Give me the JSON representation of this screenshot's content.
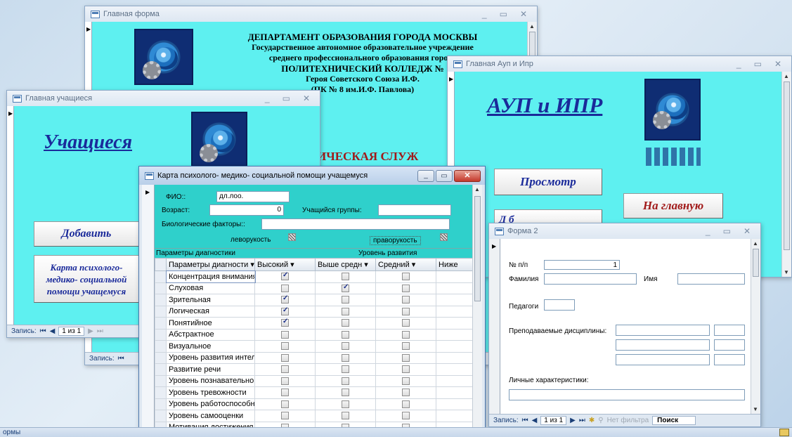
{
  "main_form": {
    "title": "Главная форма",
    "header_lines": [
      "ДЕПАРТАМЕНТ ОБРАЗОВАНИЯ ГОРОДА МОСКВЫ",
      "Государственное автономное образовательное учреждение",
      "среднего профессионального образования города",
      "ПОЛИТЕХНИЧЕСКИЙ КОЛЛЕДЖ №",
      "Героя Советского Союза И.Ф.",
      "(ПК № 8 им.И.Ф. Павлова)"
    ],
    "service_title": "ИЧЕСКАЯ СЛУЖ",
    "nav_record": "Запись:"
  },
  "aup_form": {
    "title": "Главная Ауп и Ипр",
    "heading": "АУП и ИПР",
    "view_button": "Просмотр",
    "home_button": "На главную",
    "partial_button": "Д б"
  },
  "students_form": {
    "title": "Главная учащиеся",
    "heading": "Учащиеся",
    "add_button": "Добавить",
    "card_button": "Карта психолого-медико- социальной помощи учащемуся",
    "nav": {
      "label": "Запись:",
      "current": "1 из 1"
    }
  },
  "card_form": {
    "title": "Карта психолого- медико- социальной помощи учащемуся",
    "fio_label": "ФИО::",
    "fio_value": "дл.лоо.",
    "age_label": "Возраст:",
    "age_value": "0",
    "group_label": "Учащийся группы:",
    "group_value": "",
    "bio_label": "Биологические факторы::",
    "bio_value": "",
    "left_handed_label": "леворукость",
    "right_handed_label": "праворукость",
    "params_label": "Параметры диагностики",
    "level_label": "Уровень развития",
    "columns": [
      "Параметры диагности ▾",
      "Высокий ▾",
      "Выше средн ▾",
      "Средний ▾",
      "Ниже"
    ],
    "rows": [
      {
        "name": "Концентрация внимания",
        "high": true,
        "above": false,
        "mid": false
      },
      {
        "name": "Слуховая",
        "high": false,
        "above": true,
        "mid": false
      },
      {
        "name": "Зрительная",
        "high": true,
        "above": false,
        "mid": false
      },
      {
        "name": "Логическая",
        "high": true,
        "above": false,
        "mid": false
      },
      {
        "name": "Понятийное",
        "high": true,
        "above": false,
        "mid": false
      },
      {
        "name": "Абстрактное",
        "high": false,
        "above": false,
        "mid": false
      },
      {
        "name": "Визуальное",
        "high": false,
        "above": false,
        "mid": false
      },
      {
        "name": "Уровень развития интеле",
        "high": false,
        "above": false,
        "mid": false
      },
      {
        "name": "Развитие речи",
        "high": false,
        "above": false,
        "mid": false
      },
      {
        "name": "Уровень познавательной",
        "high": false,
        "above": false,
        "mid": false
      },
      {
        "name": "Уровень тревожности",
        "high": false,
        "above": false,
        "mid": false
      },
      {
        "name": "Уровень работоспособно",
        "high": false,
        "above": false,
        "mid": false
      },
      {
        "name": "Уровень самооценки",
        "high": false,
        "above": false,
        "mid": false
      },
      {
        "name": "Мотивация достижения",
        "high": false,
        "above": false,
        "mid": false
      }
    ]
  },
  "form2": {
    "title": "Форма 2",
    "num_label": "№ п/п",
    "num_value": "1",
    "surname_label": "Фамилия",
    "name_label": "Имя",
    "teacher_label": "Педагоги",
    "disciplines_label": "Преподаваемые дисциплины:",
    "traits_label": "Личные характеристики:",
    "nav": {
      "label": "Запись:",
      "current": "1 из 1",
      "filter": "Нет фильтра",
      "search": "Поиск"
    }
  },
  "statusbar": {
    "text": "ормы"
  },
  "colors": {
    "form_bg": "#5ef0f0",
    "heading": "#1a2a9a",
    "service": "#a11a1a",
    "card_title_active": "#c9d9ee"
  }
}
